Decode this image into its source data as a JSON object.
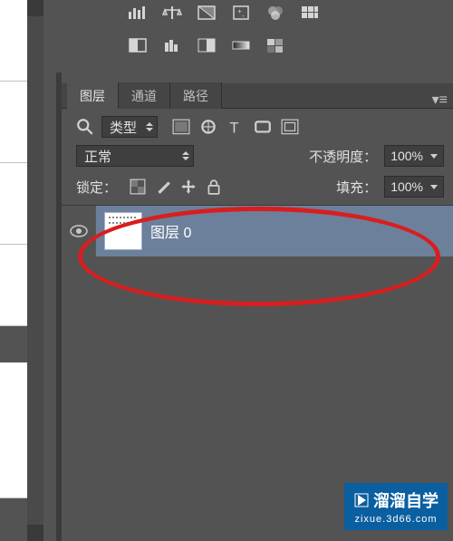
{
  "tabs": {
    "layers": "图层",
    "channels": "通道",
    "paths": "路径"
  },
  "filter": {
    "kind_label": "类型"
  },
  "blend": {
    "mode": "正常",
    "opacity_label": "不透明度：",
    "opacity_value": "100%"
  },
  "lock": {
    "label": "锁定：",
    "fill_label": "填充：",
    "fill_value": "100%"
  },
  "layer0": {
    "name": "图层 0"
  },
  "watermark": {
    "title": "溜溜自学",
    "sub": "zixue.3d66.com"
  }
}
